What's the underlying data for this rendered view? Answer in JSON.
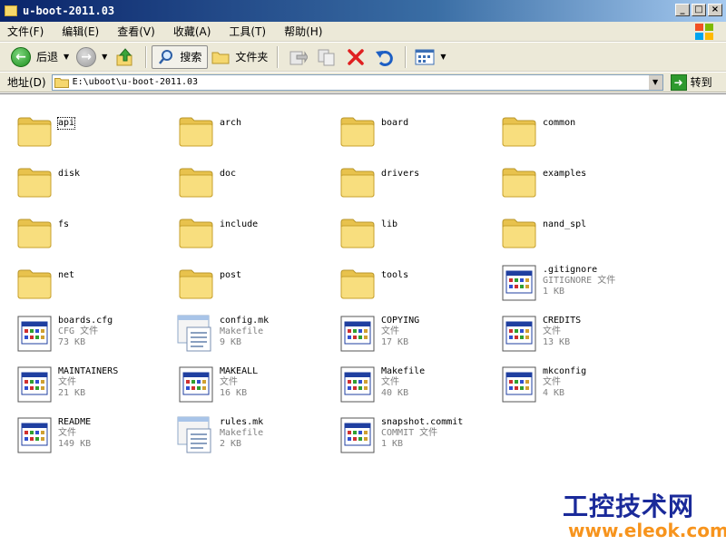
{
  "window": {
    "title": "u-boot-2011.03"
  },
  "menu": [
    "文件(F)",
    "编辑(E)",
    "查看(V)",
    "收藏(A)",
    "工具(T)",
    "帮助(H)"
  ],
  "toolbar": {
    "back_label": "后退",
    "search_label": "搜索",
    "folders_label": "文件夹"
  },
  "address": {
    "label": "地址(D)",
    "value": "E:\\uboot\\u-boot-2011.03",
    "go_label": "转到"
  },
  "items": [
    {
      "name": "api",
      "type": "folder"
    },
    {
      "name": "arch",
      "type": "folder"
    },
    {
      "name": "board",
      "type": "folder"
    },
    {
      "name": "common",
      "type": "folder"
    },
    {
      "name": "disk",
      "type": "folder"
    },
    {
      "name": "doc",
      "type": "folder"
    },
    {
      "name": "drivers",
      "type": "folder"
    },
    {
      "name": "examples",
      "type": "folder"
    },
    {
      "name": "fs",
      "type": "folder"
    },
    {
      "name": "include",
      "type": "folder"
    },
    {
      "name": "lib",
      "type": "folder"
    },
    {
      "name": "nand_spl",
      "type": "folder"
    },
    {
      "name": "net",
      "type": "folder"
    },
    {
      "name": "post",
      "type": "folder"
    },
    {
      "name": "tools",
      "type": "folder"
    },
    {
      "name": ".gitignore",
      "type": "file",
      "kind": "GITIGNORE 文件",
      "size": "1 KB"
    },
    {
      "name": "boards.cfg",
      "type": "file",
      "kind": "CFG 文件",
      "size": "73 KB"
    },
    {
      "name": "config.mk",
      "type": "makefile",
      "kind": "Makefile",
      "size": "9 KB"
    },
    {
      "name": "COPYING",
      "type": "file",
      "kind": "文件",
      "size": "17 KB"
    },
    {
      "name": "CREDITS",
      "type": "file",
      "kind": "文件",
      "size": "13 KB"
    },
    {
      "name": "MAINTAINERS",
      "type": "file",
      "kind": "文件",
      "size": "21 KB"
    },
    {
      "name": "MAKEALL",
      "type": "file",
      "kind": "文件",
      "size": "16 KB"
    },
    {
      "name": "Makefile",
      "type": "file",
      "kind": "文件",
      "size": "40 KB"
    },
    {
      "name": "mkconfig",
      "type": "file",
      "kind": "文件",
      "size": "4 KB"
    },
    {
      "name": "README",
      "type": "file",
      "kind": "文件",
      "size": "149 KB"
    },
    {
      "name": "rules.mk",
      "type": "makefile",
      "kind": "Makefile",
      "size": "2 KB"
    },
    {
      "name": "snapshot.commit",
      "type": "file",
      "kind": "COMMIT 文件",
      "size": "1 KB"
    }
  ],
  "watermark": {
    "title": "工控技术网",
    "url": "www.eleok.com"
  }
}
